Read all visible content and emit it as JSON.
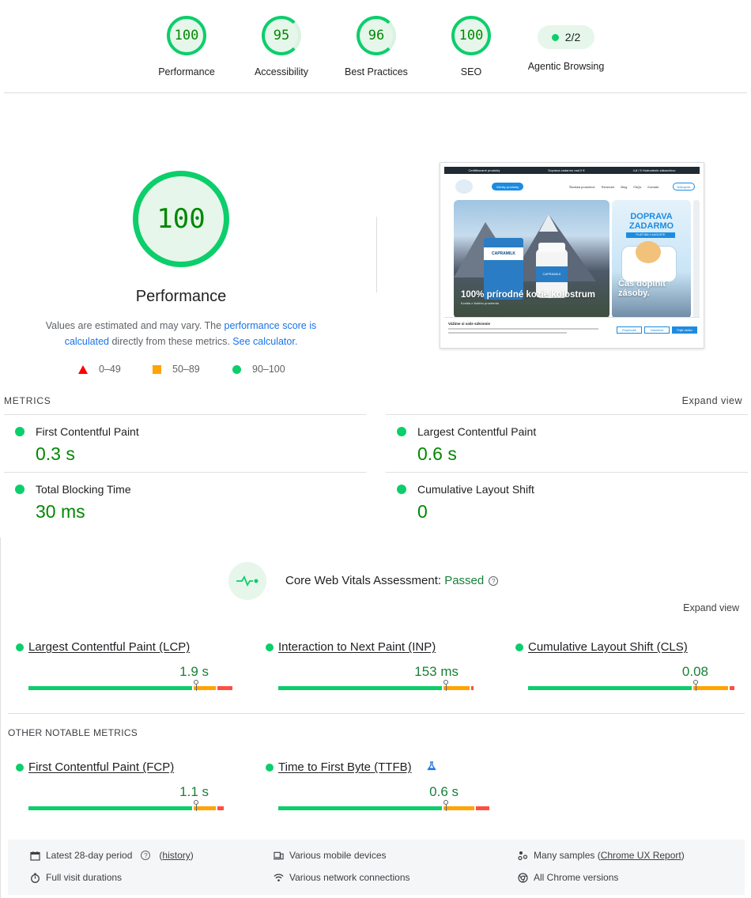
{
  "top_gauges": [
    {
      "score": "100",
      "label": "Performance"
    },
    {
      "score": "95",
      "label": "Accessibility"
    },
    {
      "score": "96",
      "label": "Best Practices"
    },
    {
      "score": "100",
      "label": "SEO"
    }
  ],
  "agentic": {
    "value": "2/2",
    "label": "Agentic Browsing"
  },
  "performance": {
    "score": "100",
    "title": "Performance",
    "note_prefix": "Values are estimated and may vary. The ",
    "note_link1": "performance score is calculated",
    "note_mid": " directly from these metrics. ",
    "note_link2": "See calculator.",
    "legend": [
      {
        "range": "0–49",
        "color": "#ff0000"
      },
      {
        "range": "50–89",
        "color": "#ffa400"
      },
      {
        "range": "90–100",
        "color": "#0cce6b"
      }
    ]
  },
  "thumbnail": {
    "topbar": [
      "Certifikované produkty",
      "Doprava zadarmo nad 0 €",
      "4.8 / 5 Hodnotenie zákazníkov"
    ],
    "nav_button": "Všetky produkty",
    "nav_links": [
      "Školská produktov",
      "Recenzie",
      "Blog",
      "FAQs",
      "Kontakt"
    ],
    "cart": "Nákupník",
    "box_brand": "CAPRAMILK",
    "bottle_brand": "CAPRAMILK",
    "hero_text": "100% prírodné kozie kolostrum",
    "hero_sub": "Kvalita z čistého prostredia",
    "promo_title": "DOPRAVA ZADARMO",
    "promo_tag": "PLATÍ IBA V AUGUSTE",
    "promo_text": "Čas doplniť zásoby.",
    "cookie_title": "Vážime si vaše súkromie",
    "cookie_buttons": [
      "Prispôsobiť",
      "Odmietnuť",
      "Prijať všetko"
    ]
  },
  "metrics": {
    "heading": "METRICS",
    "expand": "Expand view",
    "items": [
      {
        "name": "First Contentful Paint",
        "value": "0.3 s"
      },
      {
        "name": "Largest Contentful Paint",
        "value": "0.6 s"
      },
      {
        "name": "Total Blocking Time",
        "value": "30 ms"
      },
      {
        "name": "Cumulative Layout Shift",
        "value": "0"
      }
    ]
  },
  "cwv": {
    "title_prefix": "Core Web Vitals Assessment: ",
    "status": "Passed",
    "expand": "Expand view",
    "core": [
      {
        "name": "Largest Contentful Paint (LCP)",
        "value": "1.9 s",
        "good": 0.75,
        "ni": 0.1,
        "poor": 0.07,
        "marker": 0.75
      },
      {
        "name": "Interaction to Next Paint (INP)",
        "value": "153 ms",
        "good": 0.75,
        "ni": 0.12,
        "poor": 0.01,
        "marker": 0.75
      },
      {
        "name": "Cumulative Layout Shift (CLS)",
        "value": "0.08",
        "good": 0.75,
        "ni": 0.16,
        "poor": 0.02,
        "marker": 0.75
      }
    ],
    "other_heading": "OTHER NOTABLE METRICS",
    "other": [
      {
        "name": "First Contentful Paint (FCP)",
        "value": "1.1 s",
        "good": 0.75,
        "ni": 0.1,
        "poor": 0.03,
        "marker": 0.75
      },
      {
        "name": "Time to First Byte (TTFB)",
        "value": "0.6 s",
        "good": 0.75,
        "ni": 0.14,
        "poor": 0.06,
        "marker": 0.75
      }
    ]
  },
  "info": {
    "period": "Latest 28-day period",
    "history": "history",
    "devices": "Various mobile devices",
    "samples_prefix": "Many samples (",
    "samples_link": "Chrome UX Report",
    "samples_suffix": ")",
    "durations": "Full visit durations",
    "network": "Various network connections",
    "versions": "All Chrome versions"
  }
}
